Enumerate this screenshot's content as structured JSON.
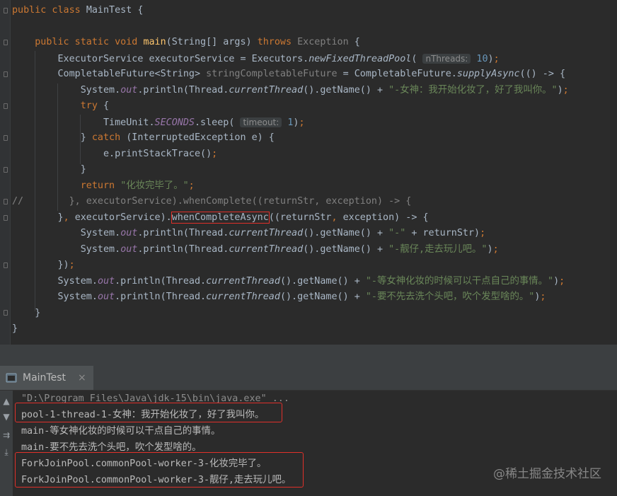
{
  "code_lines": [
    {
      "segments": [
        [
          "kw",
          "public class "
        ],
        [
          "",
          "MainTest {"
        ]
      ]
    },
    {
      "segments": []
    },
    {
      "segments": [
        [
          "",
          "    "
        ],
        [
          "kw",
          "public static void "
        ],
        [
          "fn",
          "main"
        ],
        [
          "",
          "(String[] args) "
        ],
        [
          "kw",
          "throws "
        ],
        [
          "gray",
          "Exception "
        ],
        [
          "",
          "{"
        ]
      ]
    },
    {
      "segments": [
        [
          "",
          "        ExecutorService executorService = Executors."
        ],
        [
          "it",
          "newFixedThreadPool"
        ],
        [
          "",
          "( "
        ],
        [
          "hint",
          "nThreads:"
        ],
        [
          "",
          " "
        ],
        [
          "num",
          "10"
        ],
        [
          "",
          ")"
        ],
        [
          "kw",
          ";"
        ]
      ]
    },
    {
      "segments": [
        [
          "",
          "        CompletableFuture<String> "
        ],
        [
          "gray",
          "stringCompletableFuture"
        ],
        [
          "",
          " = CompletableFuture."
        ],
        [
          "it",
          "supplyAsync"
        ],
        [
          "",
          "(() -> {"
        ]
      ]
    },
    {
      "segments": [
        [
          "",
          "            System."
        ],
        [
          "fld",
          "out"
        ],
        [
          "",
          ".println(Thread."
        ],
        [
          "it",
          "currentThread"
        ],
        [
          "",
          "().getName() + "
        ],
        [
          "str",
          "\"-女神：我开始化妆了，好了我叫你。\""
        ],
        [
          "",
          ")"
        ],
        [
          "kw",
          ";"
        ]
      ]
    },
    {
      "segments": [
        [
          "",
          "            "
        ],
        [
          "kw",
          "try "
        ],
        [
          "",
          "{"
        ]
      ]
    },
    {
      "segments": [
        [
          "",
          "                TimeUnit."
        ],
        [
          "sfld",
          "SECONDS"
        ],
        [
          "",
          ".sleep( "
        ],
        [
          "hint",
          "timeout:"
        ],
        [
          "",
          " "
        ],
        [
          "num",
          "1"
        ],
        [
          "",
          ")"
        ],
        [
          "kw",
          ";"
        ]
      ]
    },
    {
      "segments": [
        [
          "",
          "            } "
        ],
        [
          "kw",
          "catch "
        ],
        [
          "",
          "(InterruptedException e) {"
        ]
      ]
    },
    {
      "segments": [
        [
          "",
          "                e.printStackTrace()"
        ],
        [
          "kw",
          ";"
        ]
      ]
    },
    {
      "segments": [
        [
          "",
          "            }"
        ]
      ]
    },
    {
      "segments": [
        [
          "",
          "            "
        ],
        [
          "kw",
          "return "
        ],
        [
          "str",
          "\"化妆完毕了。\""
        ],
        [
          "kw",
          ";"
        ]
      ]
    },
    {
      "segments": [
        [
          "cmt",
          "//        }, executorService).whenComplete((returnStr, exception) -> {"
        ]
      ]
    },
    {
      "segments": [
        [
          "",
          "        }"
        ],
        [
          "kw",
          ", "
        ],
        [
          "",
          "executorService)."
        ],
        [
          "boxed",
          "whenCompleteAsync"
        ],
        [
          "",
          "((returnStr"
        ],
        [
          "kw",
          ", "
        ],
        [
          "",
          "exception) -> {"
        ]
      ]
    },
    {
      "segments": [
        [
          "",
          "            System."
        ],
        [
          "fld",
          "out"
        ],
        [
          "",
          ".println(Thread."
        ],
        [
          "it",
          "currentThread"
        ],
        [
          "",
          "().getName() + "
        ],
        [
          "str",
          "\"-\""
        ],
        [
          "",
          " + returnStr)"
        ],
        [
          "kw",
          ";"
        ]
      ]
    },
    {
      "segments": [
        [
          "",
          "            System."
        ],
        [
          "fld",
          "out"
        ],
        [
          "",
          ".println(Thread."
        ],
        [
          "it",
          "currentThread"
        ],
        [
          "",
          "().getName() + "
        ],
        [
          "str",
          "\"-靓仔,走去玩儿吧。\""
        ],
        [
          "",
          ")"
        ],
        [
          "kw",
          ";"
        ]
      ]
    },
    {
      "segments": [
        [
          "",
          "        })"
        ],
        [
          "kw",
          ";"
        ]
      ]
    },
    {
      "segments": [
        [
          "",
          "        System."
        ],
        [
          "fld",
          "out"
        ],
        [
          "",
          ".println(Thread."
        ],
        [
          "it",
          "currentThread"
        ],
        [
          "",
          "().getName() + "
        ],
        [
          "str",
          "\"-等女神化妆的时候可以干点自己的事情。\""
        ],
        [
          "",
          ")"
        ],
        [
          "kw",
          ";"
        ]
      ]
    },
    {
      "segments": [
        [
          "",
          "        System."
        ],
        [
          "fld",
          "out"
        ],
        [
          "",
          ".println(Thread."
        ],
        [
          "it",
          "currentThread"
        ],
        [
          "",
          "().getName() + "
        ],
        [
          "str",
          "\"-要不先去洗个头吧，吹个发型啥的。\""
        ],
        [
          "",
          ")"
        ],
        [
          "kw",
          ";"
        ]
      ]
    },
    {
      "segments": [
        [
          "",
          "    }"
        ]
      ]
    },
    {
      "segments": [
        [
          "",
          "}"
        ]
      ]
    }
  ],
  "run_panel": {
    "tab_label": "MainTest",
    "close_glyph": "×"
  },
  "console_lines": [
    "\"D:\\Program Files\\Java\\jdk-15\\bin\\java.exe\" ...",
    "pool-1-thread-1-女神：我开始化妆了，好了我叫你。",
    "main-等女神化妆的时候可以干点自己的事情。",
    "main-要不先去洗个头吧，吹个发型啥的。",
    "ForkJoinPool.commonPool-worker-3-化妆完毕了。",
    "ForkJoinPool.commonPool-worker-3-靓仔,走去玩儿吧。"
  ],
  "watermark": "@稀土掘金技术社区",
  "colors": {
    "editor_bg": "#2b2b2b",
    "keyword": "#cc7832",
    "string": "#6a8759",
    "number": "#6897bb",
    "field": "#9876aa",
    "method_decl": "#ffc66d",
    "highlight_box": "#e0302a"
  }
}
